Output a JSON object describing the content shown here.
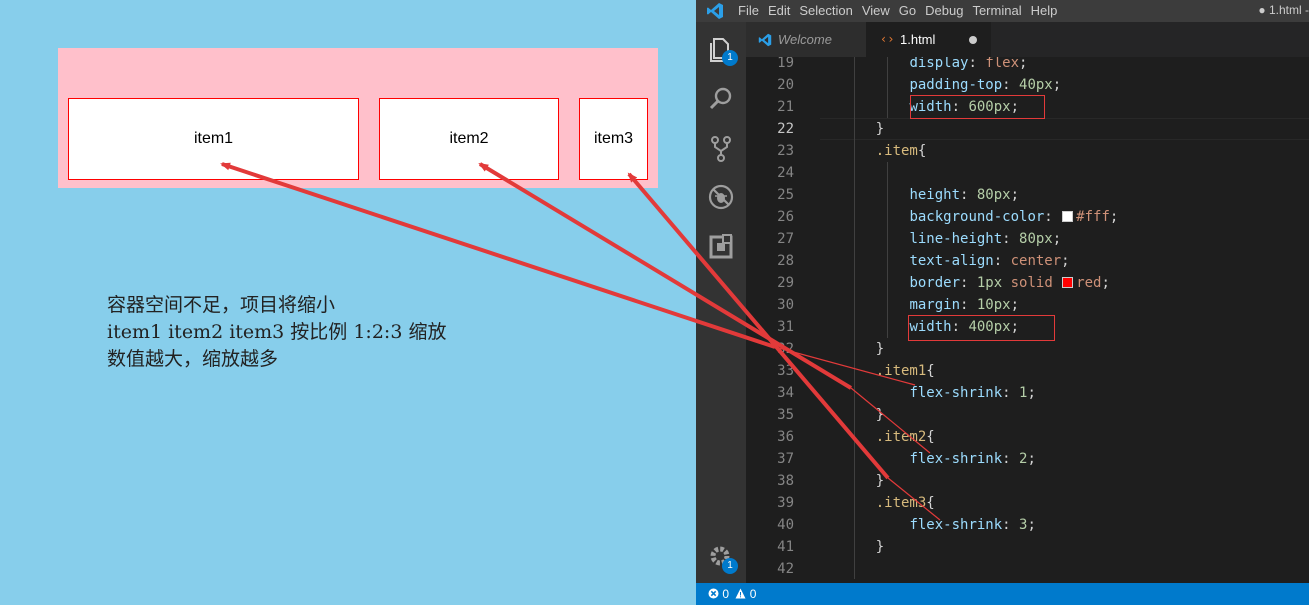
{
  "demo": {
    "items": [
      "item1",
      "item2",
      "item3"
    ],
    "note_lines": [
      "容器空间不足，项目将缩小",
      "item1 item2 item3 按比例 1:2:3 缩放",
      "数值越大，缩放越多"
    ]
  },
  "vscode": {
    "menu": [
      "File",
      "Edit",
      "Selection",
      "View",
      "Go",
      "Debug",
      "Terminal",
      "Help"
    ],
    "window_title": "● 1.html - ",
    "activity": {
      "explorer_badge": "1",
      "settings_badge": "1"
    },
    "tabs": [
      {
        "label": "Welcome",
        "icon": "vscode-logo-icon"
      },
      {
        "label": "1.html",
        "icon": "html-code-icon",
        "dirty": true
      }
    ],
    "editor": {
      "active_line": "22",
      "lines": [
        {
          "n": "19",
          "tokens": [
            {
              "t": "        "
            },
            {
              "t": "display",
              "c": "prop"
            },
            {
              "t": ": "
            },
            {
              "t": "flex",
              "c": "val"
            },
            {
              "t": ";"
            }
          ]
        },
        {
          "n": "20",
          "tokens": [
            {
              "t": "        "
            },
            {
              "t": "padding-top",
              "c": "prop"
            },
            {
              "t": ": "
            },
            {
              "t": "40px",
              "c": "num"
            },
            {
              "t": ";"
            }
          ]
        },
        {
          "n": "21",
          "tokens": [
            {
              "t": "        "
            },
            {
              "t": "width",
              "c": "prop"
            },
            {
              "t": ": "
            },
            {
              "t": "600px",
              "c": "num"
            },
            {
              "t": ";"
            }
          ]
        },
        {
          "n": "22",
          "tokens": [
            {
              "t": "    }"
            }
          ]
        },
        {
          "n": "23",
          "tokens": [
            {
              "t": "    "
            },
            {
              "t": ".item",
              "c": "sel"
            },
            {
              "t": "{"
            }
          ]
        },
        {
          "n": "24",
          "tokens": [
            {
              "t": ""
            }
          ]
        },
        {
          "n": "25",
          "tokens": [
            {
              "t": "        "
            },
            {
              "t": "height",
              "c": "prop"
            },
            {
              "t": ": "
            },
            {
              "t": "80px",
              "c": "num"
            },
            {
              "t": ";"
            }
          ]
        },
        {
          "n": "26",
          "tokens": [
            {
              "t": "        "
            },
            {
              "t": "background-color",
              "c": "prop"
            },
            {
              "t": ": "
            },
            {
              "swatch": "#ffffff"
            },
            {
              "t": "#fff",
              "c": "val"
            },
            {
              "t": ";"
            }
          ]
        },
        {
          "n": "27",
          "tokens": [
            {
              "t": "        "
            },
            {
              "t": "line-height",
              "c": "prop"
            },
            {
              "t": ": "
            },
            {
              "t": "80px",
              "c": "num"
            },
            {
              "t": ";"
            }
          ]
        },
        {
          "n": "28",
          "tokens": [
            {
              "t": "        "
            },
            {
              "t": "text-align",
              "c": "prop"
            },
            {
              "t": ": "
            },
            {
              "t": "center",
              "c": "val"
            },
            {
              "t": ";"
            }
          ]
        },
        {
          "n": "29",
          "tokens": [
            {
              "t": "        "
            },
            {
              "t": "border",
              "c": "prop"
            },
            {
              "t": ": "
            },
            {
              "t": "1px",
              "c": "num"
            },
            {
              "t": " "
            },
            {
              "t": "solid",
              "c": "val"
            },
            {
              "t": " "
            },
            {
              "swatch": "#ff0000"
            },
            {
              "t": "red",
              "c": "val"
            },
            {
              "t": ";"
            }
          ]
        },
        {
          "n": "30",
          "tokens": [
            {
              "t": "        "
            },
            {
              "t": "margin",
              "c": "prop"
            },
            {
              "t": ": "
            },
            {
              "t": "10px",
              "c": "num"
            },
            {
              "t": ";"
            }
          ]
        },
        {
          "n": "31",
          "tokens": [
            {
              "t": "        "
            },
            {
              "t": "width",
              "c": "prop"
            },
            {
              "t": ": "
            },
            {
              "t": "400px",
              "c": "num"
            },
            {
              "t": ";"
            }
          ]
        },
        {
          "n": "32",
          "tokens": [
            {
              "t": "    }"
            }
          ]
        },
        {
          "n": "33",
          "tokens": [
            {
              "t": "    "
            },
            {
              "t": ".item1",
              "c": "sel"
            },
            {
              "t": "{"
            }
          ]
        },
        {
          "n": "34",
          "tokens": [
            {
              "t": "        "
            },
            {
              "t": "flex-shrink",
              "c": "prop"
            },
            {
              "t": ": "
            },
            {
              "t": "1",
              "c": "num"
            },
            {
              "t": ";"
            }
          ]
        },
        {
          "n": "35",
          "tokens": [
            {
              "t": "    }"
            }
          ]
        },
        {
          "n": "36",
          "tokens": [
            {
              "t": "    "
            },
            {
              "t": ".item2",
              "c": "sel"
            },
            {
              "t": "{"
            }
          ]
        },
        {
          "n": "37",
          "tokens": [
            {
              "t": "        "
            },
            {
              "t": "flex-shrink",
              "c": "prop"
            },
            {
              "t": ": "
            },
            {
              "t": "2",
              "c": "num"
            },
            {
              "t": ";"
            }
          ]
        },
        {
          "n": "38",
          "tokens": [
            {
              "t": "    }"
            }
          ]
        },
        {
          "n": "39",
          "tokens": [
            {
              "t": "    "
            },
            {
              "t": ".item3",
              "c": "sel"
            },
            {
              "t": "{"
            }
          ]
        },
        {
          "n": "40",
          "tokens": [
            {
              "t": "        "
            },
            {
              "t": "flex-shrink",
              "c": "prop"
            },
            {
              "t": ": "
            },
            {
              "t": "3",
              "c": "num"
            },
            {
              "t": ";"
            }
          ]
        },
        {
          "n": "41",
          "tokens": [
            {
              "t": "    }"
            }
          ]
        },
        {
          "n": "42",
          "tokens": [
            {
              "t": ""
            }
          ]
        }
      ]
    },
    "status": {
      "errors": "0",
      "warnings": "0"
    }
  },
  "colors": {
    "annotation_red": "#e23a3a",
    "vscode_blue": "#007acc",
    "page_bg": "#87ceeb",
    "container_bg": "#ffc0cb"
  }
}
